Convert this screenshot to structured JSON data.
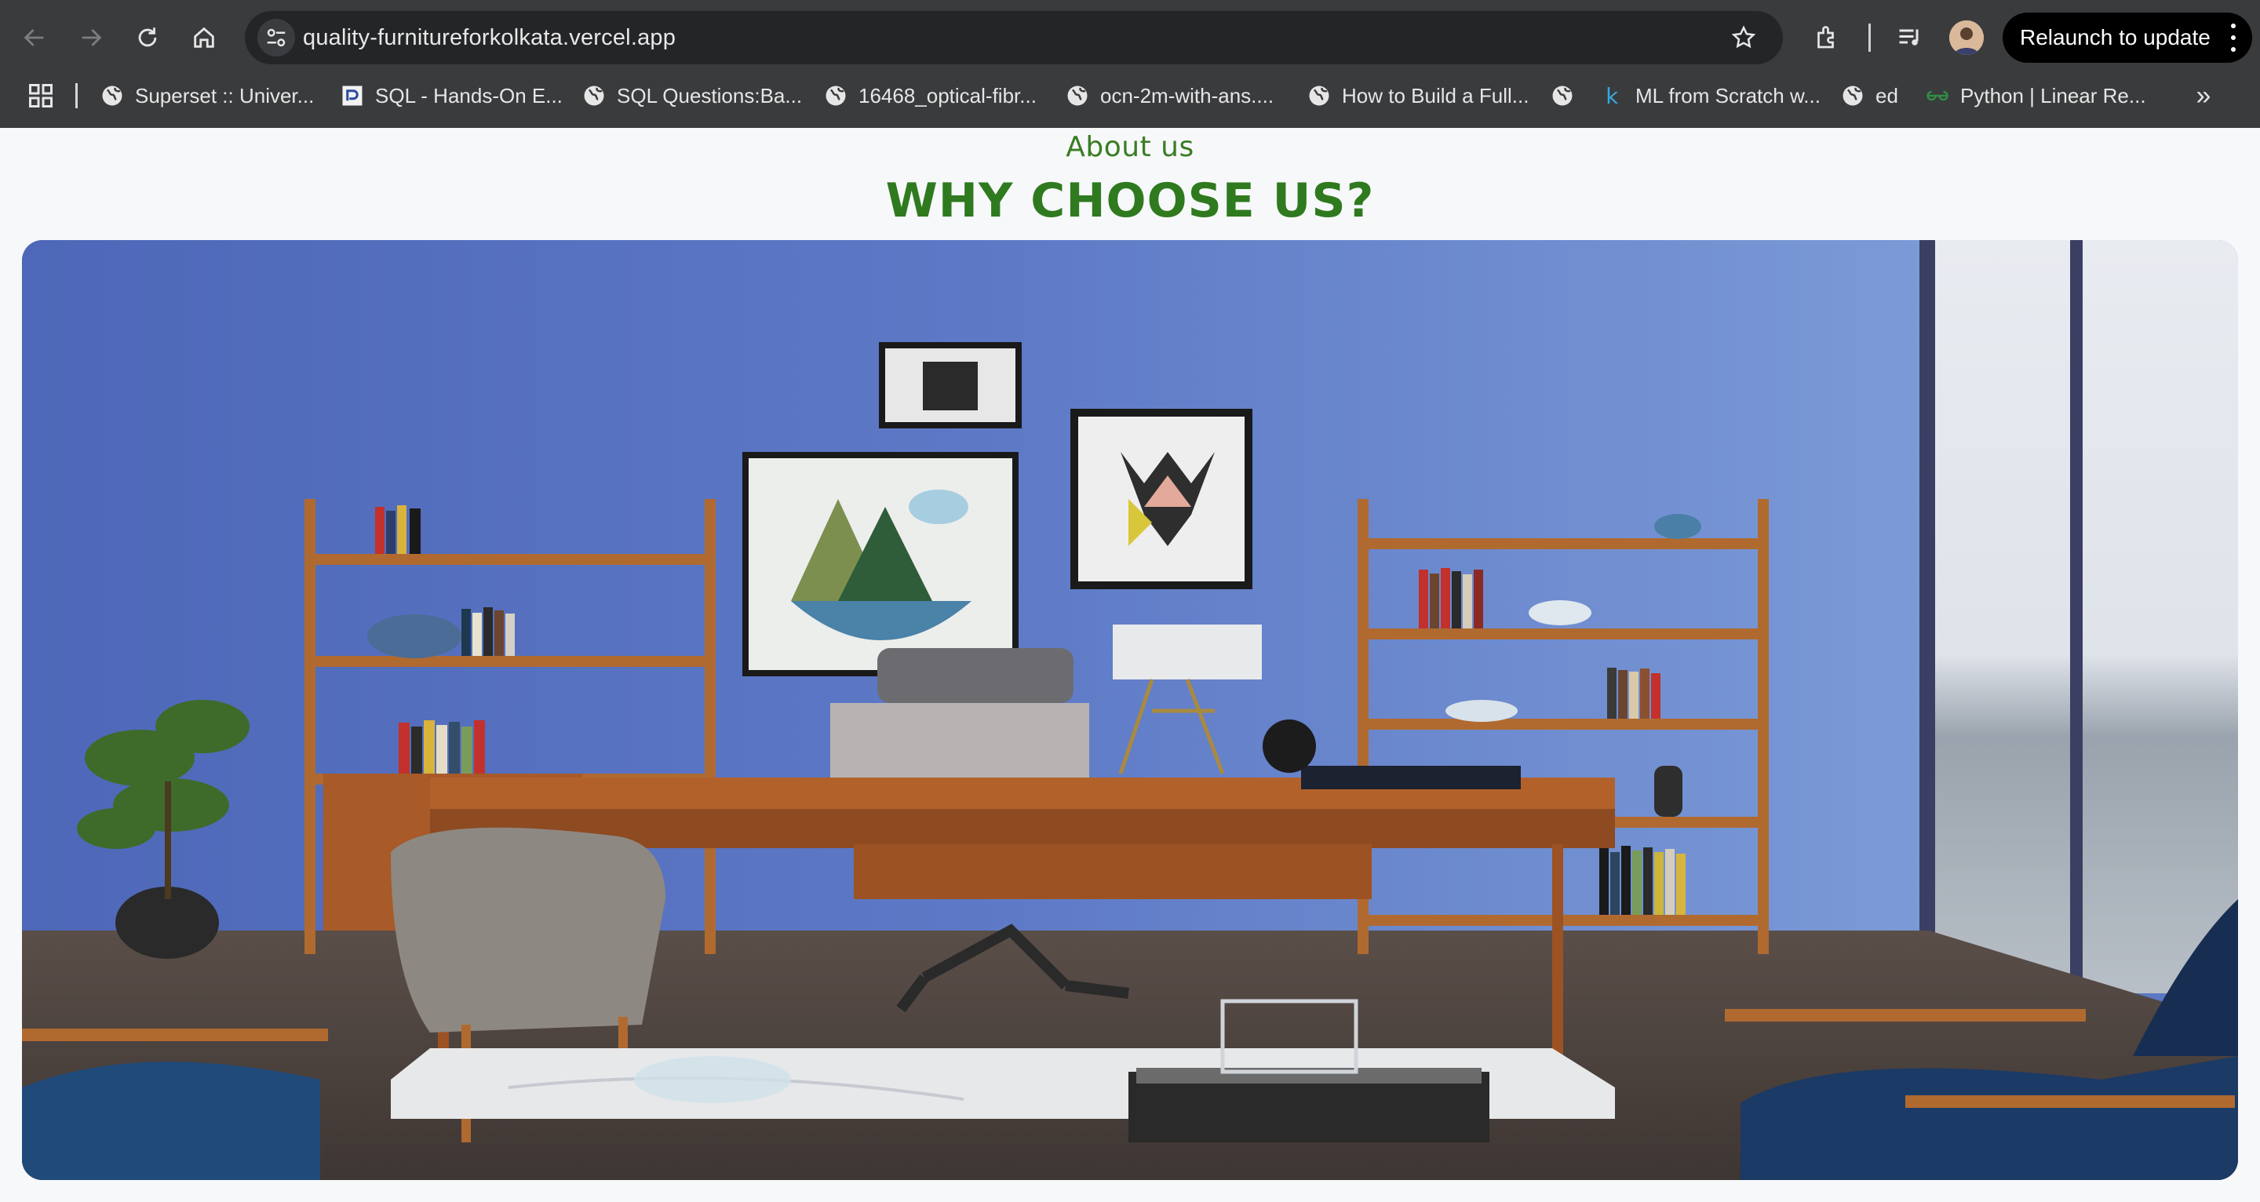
{
  "browser": {
    "url": "quality-furnitureforkolkata.vercel.app",
    "relaunch_label": "Relaunch to update",
    "bookmarks": [
      {
        "label": "Superset :: Univer...",
        "icon": "globe-icon"
      },
      {
        "label": "SQL - Hands-On E...",
        "icon": "site-logo-icon"
      },
      {
        "label": "SQL Questions:Ba...",
        "icon": "globe-icon"
      },
      {
        "label": "16468_optical-fibr...",
        "icon": "globe-icon"
      },
      {
        "label": "ocn-2m-with-ans....",
        "icon": "globe-icon"
      },
      {
        "label": "How to Build a Full...",
        "icon": "globe-icon"
      },
      {
        "label": "",
        "icon": "globe-icon"
      },
      {
        "label": "ML from Scratch w...",
        "icon": "k-logo-icon"
      },
      {
        "label": "ed",
        "icon": "globe-icon"
      },
      {
        "label": "Python | Linear Re...",
        "icon": "gfg-logo-icon"
      }
    ],
    "more_label": "»"
  },
  "page": {
    "eyebrow": "About us",
    "heading": "WHY CHOOSE US?"
  },
  "colors": {
    "heading_green": "#2f7a1f",
    "chrome_bg": "#3a3b3d",
    "wall_blue": "#5b78c4"
  }
}
